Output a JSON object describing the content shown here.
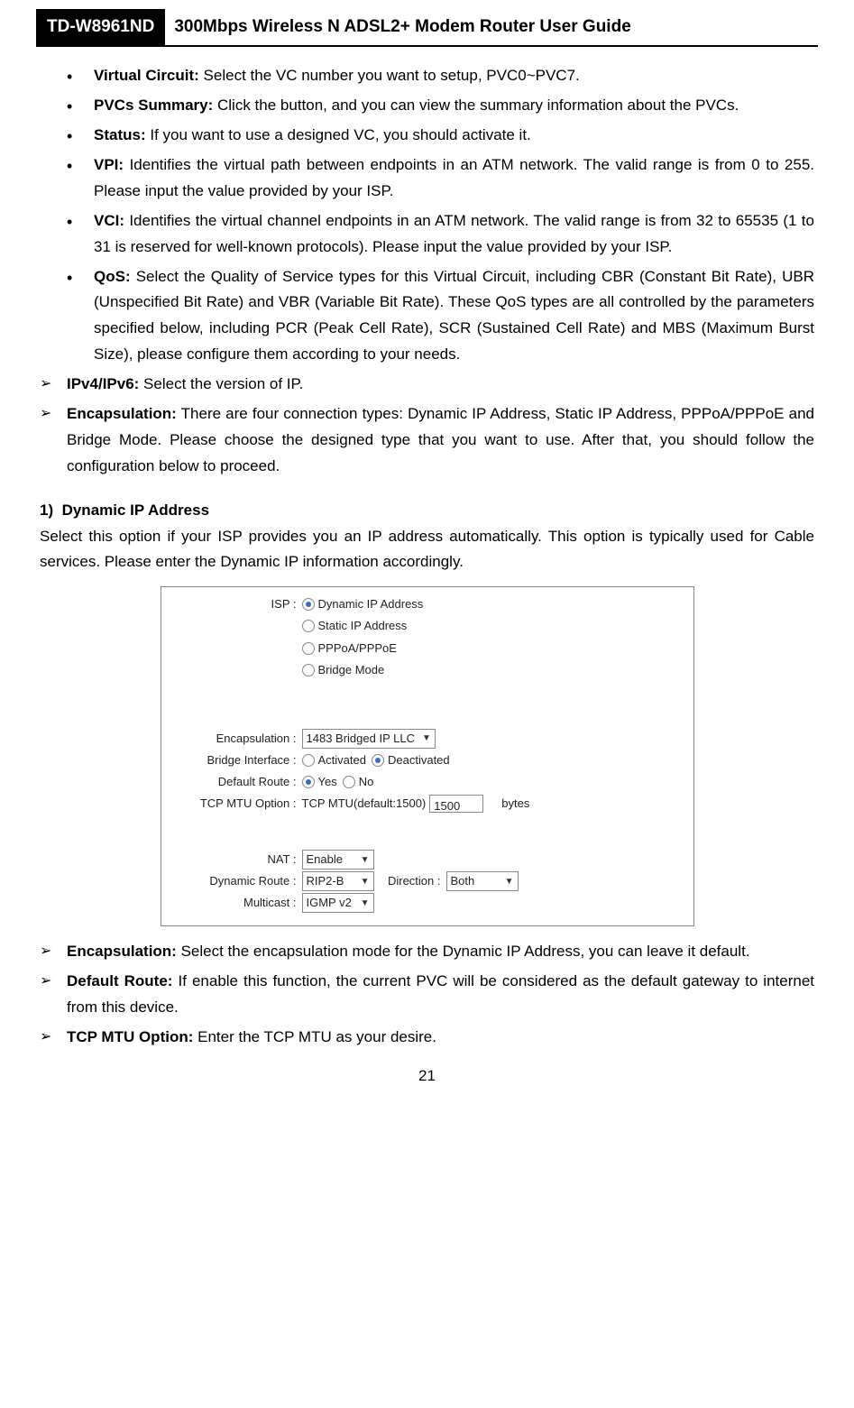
{
  "header": {
    "model": "TD-W8961ND",
    "title": "300Mbps Wireless N ADSL2+ Modem Router User Guide"
  },
  "bullets": [
    {
      "term": "Virtual Circuit:",
      "desc": " Select the VC number you want to setup, PVC0~PVC7."
    },
    {
      "term": "PVCs Summary:",
      "desc": " Click the button, and you can view the summary information about the PVCs."
    },
    {
      "term": "Status:",
      "desc": " If you want to use a designed VC, you should activate it."
    },
    {
      "term": "VPI:",
      "desc": " Identifies the virtual path between endpoints in an ATM network. The valid range is from 0 to 255. Please input the value provided by your ISP."
    },
    {
      "term": "VCI:",
      "desc": " Identifies the virtual channel endpoints in an ATM network. The valid range is from 32 to 65535 (1 to 31 is reserved for well-known protocols). Please input the value provided by your ISP."
    },
    {
      "term": "QoS:",
      "desc": " Select the Quality of Service types for this Virtual Circuit, including CBR (Constant Bit Rate), UBR (Unspecified Bit Rate) and VBR (Variable Bit Rate). These QoS types are all controlled by the parameters specified below, including PCR (Peak Cell Rate), SCR (Sustained Cell Rate) and MBS (Maximum Burst Size), please configure them according to your needs."
    }
  ],
  "arrows1": [
    {
      "term": "IPv4/IPv6:",
      "desc": " Select the version of IP."
    },
    {
      "term": "Encapsulation:",
      "desc": " There are four connection types: Dynamic IP Address, Static IP Address, PPPoA/PPPoE and Bridge Mode. Please choose the designed type that you want to use. After that, you should follow the configuration below to proceed."
    }
  ],
  "section": {
    "num": "1)",
    "title": "Dynamic IP Address",
    "desc": "Select this option if your ISP provides you an IP address automatically. This option is typically used for Cable services. Please enter the Dynamic IP information accordingly."
  },
  "figure": {
    "isp_label": "ISP :",
    "isp_options": [
      "Dynamic IP Address",
      "Static IP Address",
      "PPPoA/PPPoE",
      "Bridge Mode"
    ],
    "encapsulation_label": "Encapsulation :",
    "encapsulation_value": "1483 Bridged IP LLC",
    "bridge_label": "Bridge Interface :",
    "bridge_opts": [
      "Activated",
      "Deactivated"
    ],
    "default_route_label": "Default Route :",
    "default_route_opts": [
      "Yes",
      "No"
    ],
    "mtu_label": "TCP MTU Option :",
    "mtu_prefix": "TCP MTU(default:1500)",
    "mtu_value": "1500",
    "mtu_suffix": "bytes",
    "nat_label": "NAT :",
    "nat_value": "Enable",
    "dyn_route_label": "Dynamic Route :",
    "dyn_route_value": "RIP2-B",
    "direction_label": "Direction :",
    "direction_value": "Both",
    "multicast_label": "Multicast :",
    "multicast_value": "IGMP v2"
  },
  "arrows2": [
    {
      "term": "Encapsulation:",
      "desc": " Select the encapsulation mode for the Dynamic IP Address, you can leave it default."
    },
    {
      "term": "Default Route:",
      "desc": " If enable this function, the current PVC will be considered as the default gateway to internet from this device."
    },
    {
      "term": "TCP MTU Option:",
      "desc": " Enter the TCP MTU as your desire."
    }
  ],
  "page_number": "21"
}
